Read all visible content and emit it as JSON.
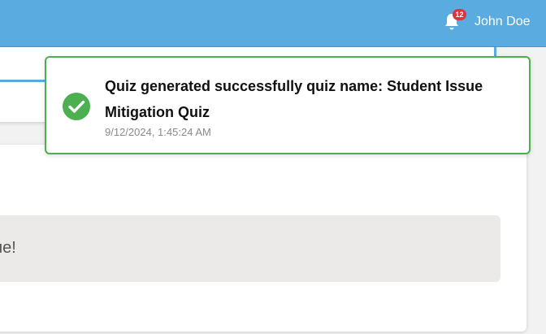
{
  "header": {
    "notification_count": "12",
    "user_name": "John Doe",
    "bell_icon": "bell-icon",
    "accent_color": "#5aace0"
  },
  "main": {
    "message_text": "ue!"
  },
  "toast": {
    "title": "Quiz generated successfully quiz name: Student Issue Mitigation Quiz",
    "timestamp": "9/12/2024, 1:45:24 AM",
    "icon": "check-circle-icon",
    "status_color": "#4caf50"
  }
}
